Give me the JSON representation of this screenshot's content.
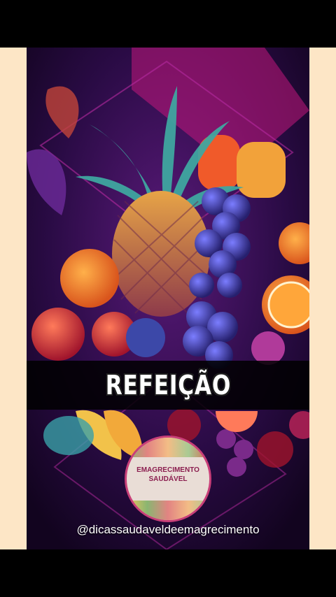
{
  "overlay": {
    "title": "REFEIÇÃO",
    "logo_line1": "EMAGRECIMENTO",
    "logo_line2": "SAUDÁVEL",
    "handle": "@dicassaudaveldeemagrecimento"
  },
  "colors": {
    "background_dark": "#1a0730",
    "accent_magenta": "#c2187b",
    "pineapple": "#e08a2a",
    "grapes": "#3b3aa8",
    "orange": "#f28c28"
  }
}
